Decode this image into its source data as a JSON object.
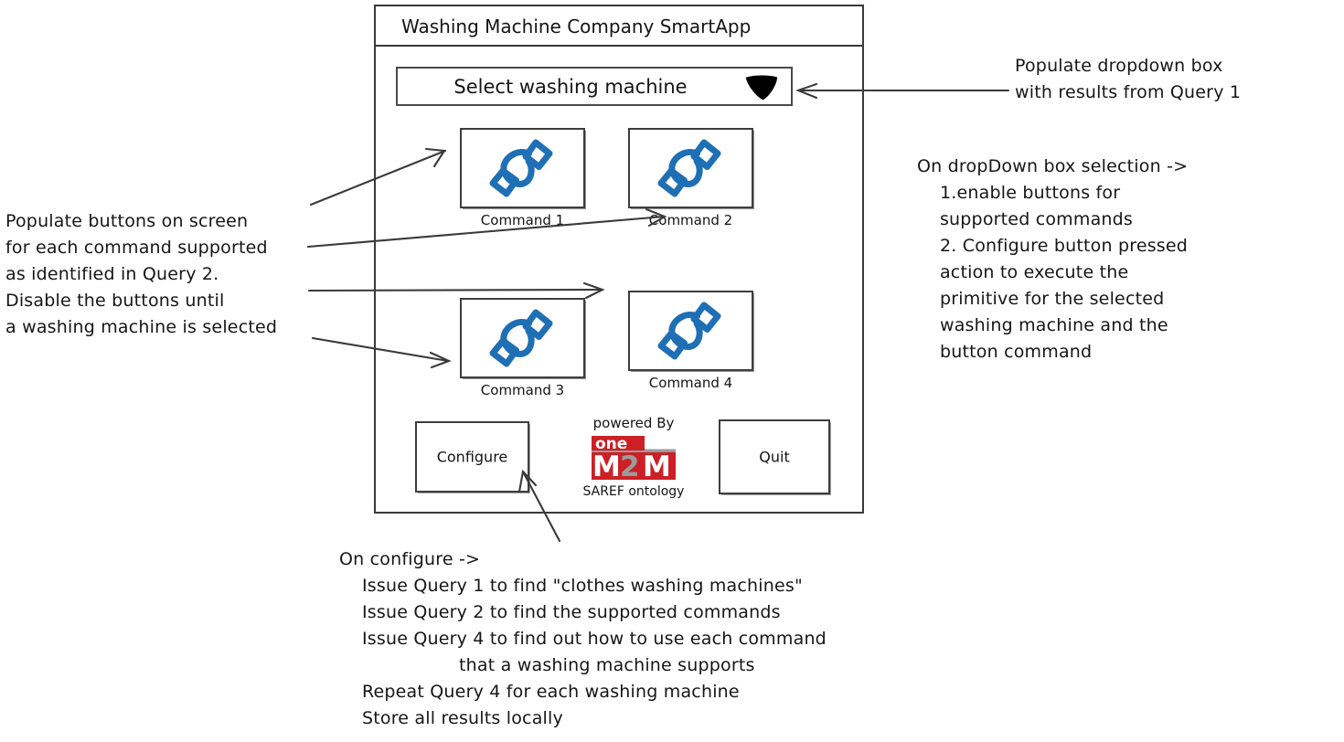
{
  "app": {
    "title": "Washing Machine Company SmartApp",
    "dropdown": {
      "name": "machine-select",
      "value": "Select washing machine",
      "arrow_icon": "triangle-down-icon"
    },
    "commands": [
      {
        "label": "Command 1",
        "icon": "command-glyph-icon"
      },
      {
        "label": "Command 2",
        "icon": "command-glyph-icon"
      },
      {
        "label": "Command 3",
        "icon": "command-glyph-icon"
      },
      {
        "label": "Command 4",
        "icon": "command-glyph-icon"
      }
    ],
    "configure_label": "Configure",
    "quit_label": "Quit",
    "powered": {
      "prefix": "powered By",
      "logo_one": "one",
      "logo_m": "M",
      "logo_2": "2",
      "logo_m2": "M",
      "suffix": "SAREF ontology"
    }
  },
  "annotations": {
    "left_buttons": "Populate buttons on screen\nfor each command supported\nas identified in Query 2.\nDisable the buttons until\na washing machine is selected",
    "dropdown_populate": "Populate dropdown box\nwith results from Query 1",
    "on_selection": "On dropDown box selection ->\n    1.enable buttons for\n    supported commands\n    2. Configure button pressed\n    action to execute the\n    primitive for the selected\n    washing machine and the\n    button command",
    "on_configure": "On configure ->\n    Issue Query 1 to find \"clothes washing machines\"\n    Issue Query 2 to find the supported commands\n    Issue Query 4 to find out how to use each command\n                     that a washing machine supports\n    Repeat Query 4 for each washing machine\n    Store all results locally"
  },
  "colors": {
    "glyph_blue": "#1F6FB5",
    "logo_red": "#CC2026",
    "logo_gray": "#9B9B9B",
    "ink": "#2F2F2F"
  }
}
